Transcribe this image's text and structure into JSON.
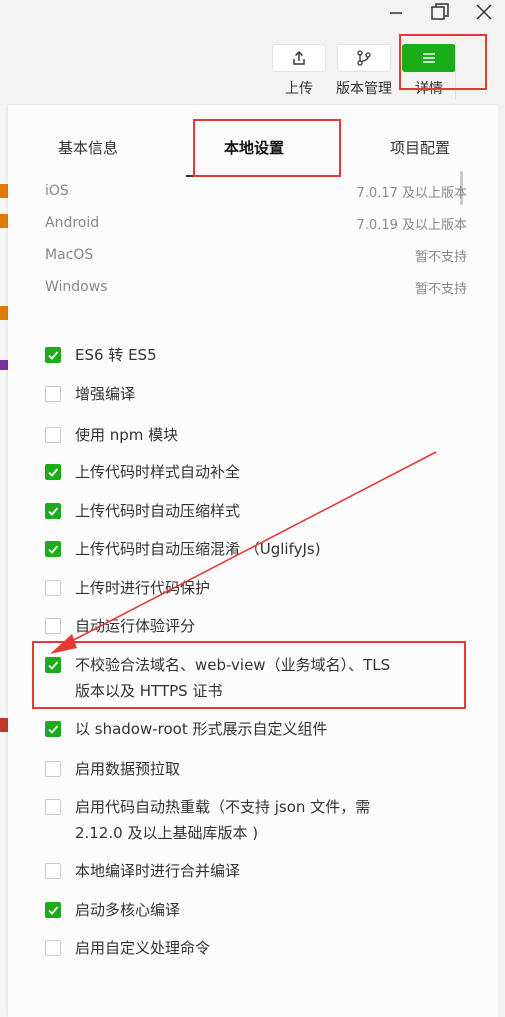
{
  "toolbar": {
    "upload_label": "上传",
    "version_label": "版本管理",
    "details_label": "详情"
  },
  "tabs": [
    {
      "label": "基本信息"
    },
    {
      "label": "本地设置"
    },
    {
      "label": "项目配置"
    }
  ],
  "active_tab": "本地设置",
  "platforms": [
    {
      "name": "iOS",
      "value": "7.0.17 及以上版本"
    },
    {
      "name": "Android",
      "value": "7.0.19 及以上版本"
    },
    {
      "name": "MacOS",
      "value": "暂不支持"
    },
    {
      "name": "Windows",
      "value": "暂不支持"
    }
  ],
  "options": [
    {
      "label": "ES6 转 ES5",
      "checked": true
    },
    {
      "label": "增强编译",
      "checked": false
    },
    {
      "label": "使用 npm 模块",
      "checked": false
    },
    {
      "label": "上传代码时样式自动补全",
      "checked": true
    },
    {
      "label": "上传代码时自动压缩样式",
      "checked": true
    },
    {
      "label": "上传代码时自动压缩混淆 （UglifyJs)",
      "checked": true
    },
    {
      "label": "上传时进行代码保护",
      "checked": false
    },
    {
      "label": "自动运行体验评分",
      "checked": false
    },
    {
      "label": "不校验合法域名、web-view（业务域名）、TLS 版本以及 HTTPS 证书",
      "checked": true
    },
    {
      "label": "以 shadow-root 形式展示自定义组件",
      "checked": true
    },
    {
      "label": "启用数据预拉取",
      "checked": false
    },
    {
      "label": "启用代码自动热重载（不支持 json 文件，需 2.12.0 及以上基础库版本 )",
      "checked": false
    },
    {
      "label": "本地编译时进行合并编译",
      "checked": false
    },
    {
      "label": "启动多核心编译",
      "checked": true
    },
    {
      "label": "启用自定义处理命令",
      "checked": false
    }
  ],
  "colors": {
    "accent": "#1aad19",
    "highlight": "#e53935"
  }
}
